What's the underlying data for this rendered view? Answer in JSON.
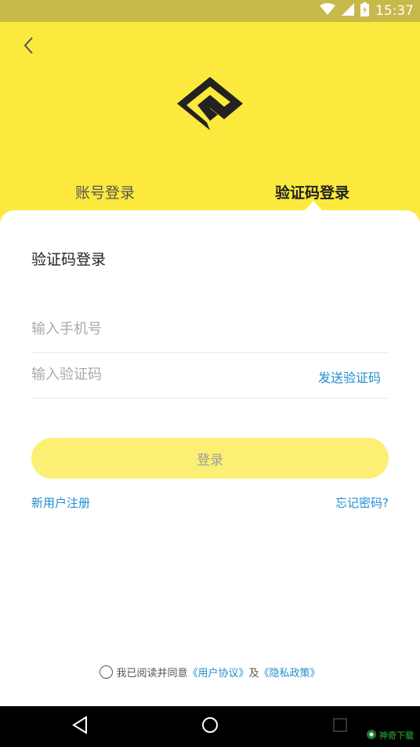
{
  "status_bar": {
    "time": "15:37",
    "icons": [
      "wifi-icon",
      "signal-icon",
      "battery-icon"
    ]
  },
  "header": {
    "back_icon": "chevron-left-icon",
    "logo": "brand-logo",
    "tabs": [
      {
        "label": "账号登录",
        "active": false
      },
      {
        "label": "验证码登录",
        "active": true
      }
    ]
  },
  "form": {
    "title": "验证码登录",
    "phone_placeholder": "输入手机号",
    "code_placeholder": "输入验证码",
    "send_code": "发送验证码",
    "login_button": "登录",
    "register_link": "新用户注册",
    "forgot_link": "忘记密码?"
  },
  "agreement": {
    "prefix": "我已阅读并同意",
    "user_agreement": "《用户协议》",
    "conjunction": "及",
    "privacy_policy": "《隐私政策》",
    "checked": false
  },
  "watermark": {
    "text": "神奇下载"
  },
  "colors": {
    "brand_yellow": "#fbea3d",
    "button_yellow": "#fcf074",
    "link_blue": "#1f8fcf",
    "status_bar": "#c7b94a"
  }
}
